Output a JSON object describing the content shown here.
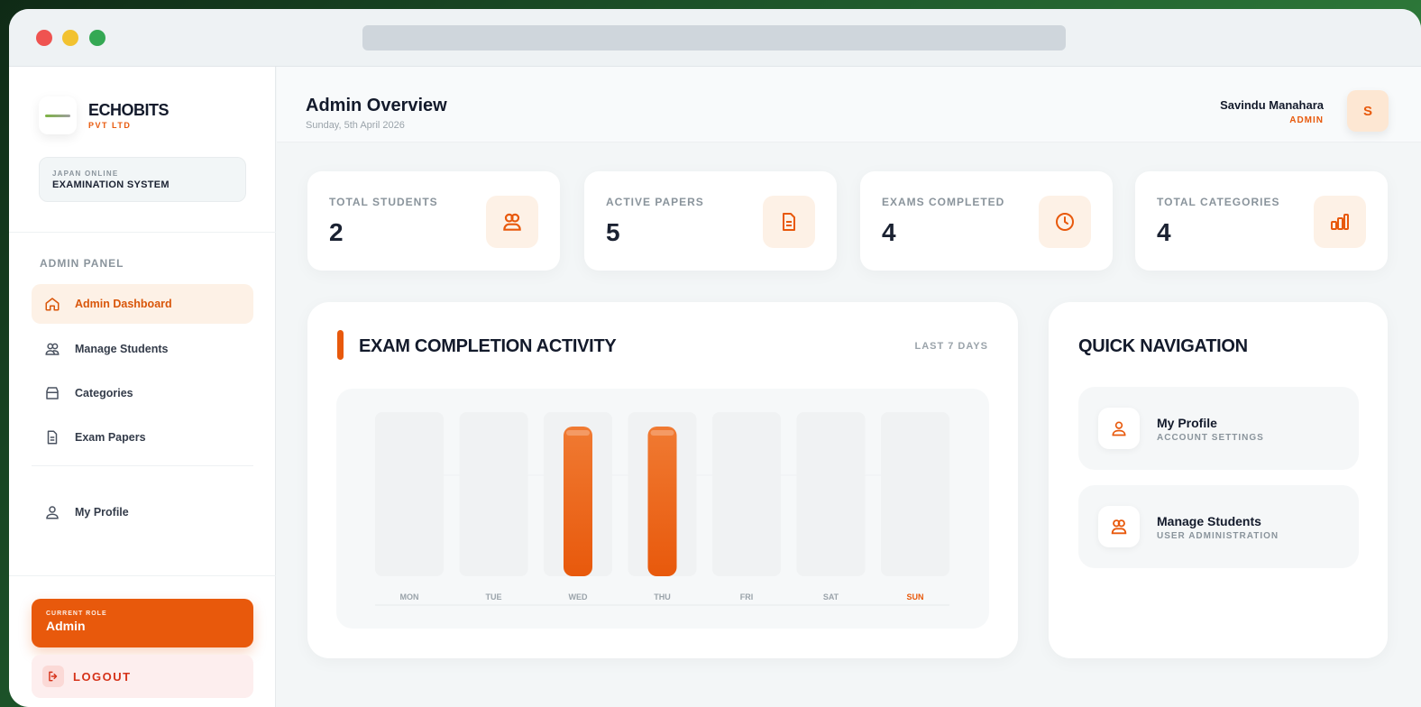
{
  "colors": {
    "accent": "#e8590c",
    "accent_soft": "#fdf1e6",
    "danger": "#d6331a"
  },
  "brand": {
    "name": "ECHOBITS",
    "sub": "PVT LTD"
  },
  "system": {
    "line1": "JAPAN ONLINE",
    "line2": "EXAMINATION SYSTEM"
  },
  "sidebar": {
    "panel_label": "ADMIN PANEL",
    "items": [
      {
        "label": "Admin Dashboard",
        "icon": "home-icon",
        "active": true
      },
      {
        "label": "Manage Students",
        "icon": "users-icon",
        "active": false
      },
      {
        "label": "Categories",
        "icon": "folder-icon",
        "active": false
      },
      {
        "label": "Exam Papers",
        "icon": "document-icon",
        "active": false
      },
      {
        "label": "My Profile",
        "icon": "user-icon",
        "active": false
      }
    ],
    "role_label": "CURRENT ROLE",
    "role_value": "Admin",
    "logout_label": "LOGOUT"
  },
  "header": {
    "title": "Admin Overview",
    "date": "Sunday, 5th April 2026",
    "user_name": "Savindu Manahara",
    "user_role": "ADMIN",
    "avatar_initial": "S"
  },
  "stats": [
    {
      "label": "TOTAL STUDENTS",
      "value": "2",
      "icon": "users-icon"
    },
    {
      "label": "ACTIVE PAPERS",
      "value": "5",
      "icon": "document-icon"
    },
    {
      "label": "EXAMS COMPLETED",
      "value": "4",
      "icon": "clock-icon"
    },
    {
      "label": "TOTAL CATEGORIES",
      "value": "4",
      "icon": "bar-chart-icon"
    }
  ],
  "activity": {
    "title": "EXAM COMPLETION ACTIVITY",
    "range": "LAST 7 DAYS"
  },
  "chart_data": {
    "type": "bar",
    "categories": [
      "MON",
      "TUE",
      "WED",
      "THU",
      "FRI",
      "SAT",
      "SUN"
    ],
    "values": [
      0,
      0,
      2,
      2,
      0,
      0,
      0
    ],
    "highlight_category": "SUN",
    "ylim": [
      0,
      2
    ],
    "title": "EXAM COMPLETION ACTIVITY",
    "xlabel": "",
    "ylabel": "",
    "grid": false
  },
  "quick_nav": {
    "title": "QUICK NAVIGATION",
    "items": [
      {
        "title": "My Profile",
        "subtitle": "ACCOUNT SETTINGS",
        "icon": "user-icon"
      },
      {
        "title": "Manage Students",
        "subtitle": "USER ADMINISTRATION",
        "icon": "users-icon"
      }
    ]
  }
}
